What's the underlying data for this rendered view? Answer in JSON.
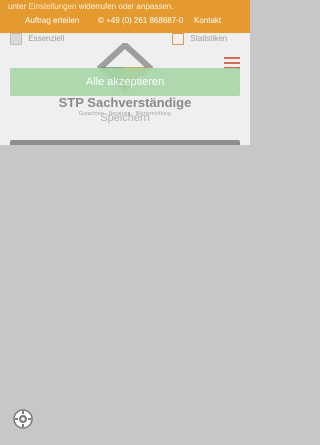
{
  "topbar": {
    "intro_prefix": "unter",
    "intro_link": "Einstellungen",
    "intro_suffix": "widerrufen oder anpassen.",
    "links": {
      "order": "Auftrag erteilen",
      "phone": "© +49 (0) 261 868687-0",
      "contact": "Kontakt"
    },
    "color": "#e49a2e"
  },
  "header": {
    "brand": "STP Sachverständige",
    "tagline": "Gutachten · Beratung · Wertermittlung",
    "logo_icon": "stp-diamond-logo",
    "menu_icon": "hamburger-icon"
  },
  "consent": {
    "essential_label": "Essenziell",
    "statistics_label": "Statistiken",
    "accept_label": "Alle akzeptieren",
    "save_label": "Speichern",
    "settings_icon": "gear-icon",
    "accept_color": "#a8d6a8"
  }
}
